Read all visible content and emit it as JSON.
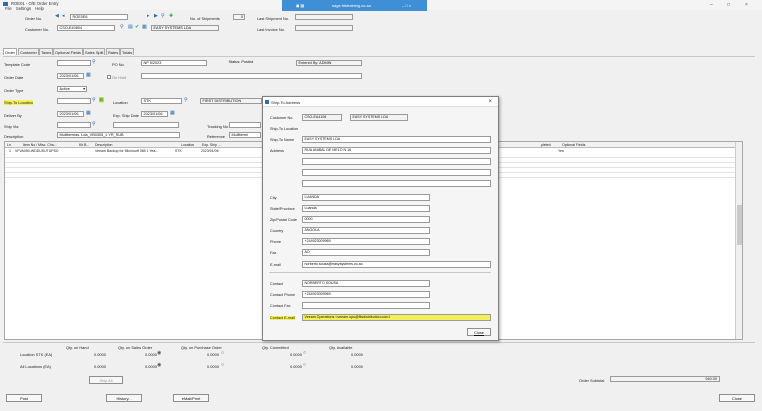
{
  "window": {
    "title": "ROE01 - O/E Order Entry",
    "menu": [
      "File",
      "Settings",
      "Help"
    ],
    "overlay_center": "sage.fitstraining.co.ao"
  },
  "header": {
    "order_no_label": "Order No.",
    "order_no": "ROE0E6",
    "no_of_shipments_label": "No. of Shipments",
    "no_of_shipments": "0",
    "last_shipment_label": "Last Shipment No.",
    "last_shipment": "",
    "customer_no_label": "Customer No.",
    "customer_no": "CSO-E40804",
    "customer_name": "EASY SYSTEMS LDA",
    "last_invoice_label": "Last Invoice No.",
    "last_invoice": ""
  },
  "tabs": [
    "Order",
    "Customer",
    "Taxes",
    "Optional Fields",
    "Sales Split",
    "Rates",
    "Totals"
  ],
  "order_tab": {
    "template_code_label": "Template Code",
    "template_code": "",
    "po_no_label": "PO No.",
    "po_no": "NP 5/2023",
    "status_text": "Status: Posted",
    "entered_by_text": "Entered By: ADMIN",
    "order_date_label": "Order Date",
    "order_date": "2023/01/06",
    "on_hold_label": "On Hold",
    "order_type_label": "Order Type",
    "order_type": "Active",
    "ship_to_location_label": "Ship-To Location",
    "ship_to_location": "",
    "location_label": "Location",
    "location": "STK",
    "location_desc": "FIRST DISTRIBUTION",
    "deliver_by_label": "Deliver By",
    "deliver_by": "2023/01/06",
    "exp_ship_date_label": "Exp. Ship Date",
    "exp_ship_date": "2023/01/06",
    "ship_via_label": "Ship Via",
    "ship_via": "",
    "tracking_label": "Tracking No.",
    "description_label": "Description",
    "description": "Multitermas. Lda_VB0305_1 YR_SUB",
    "reference_label": "Reference",
    "reference": "Multitermi"
  },
  "grid": {
    "headers": [
      "Ln",
      "Item No./ Misc. Cha...",
      "Kit B...",
      "Description",
      "Location",
      "Exp. Ship ...",
      "pleted",
      "Optional Fields"
    ],
    "rows": [
      {
        "ln": "1",
        "item": "VFVA050-WDDUSUTUPSD",
        "desc": "Veeam Backup for Microsoft 365  1 Yea...",
        "location": "STK",
        "exp_ship": "2023/01/06",
        "completed": "",
        "optional": "Yes"
      }
    ]
  },
  "summary": {
    "col_headers": [
      "Qty. on Hand",
      "Qty. on Sales Order",
      "Qty. on Purchase Order",
      "Qty. Committed",
      "Qty. Available"
    ],
    "row1_label": "Location  STK (EA)",
    "row1": [
      "0.0000",
      "0.0000",
      "0.0000",
      "0.0000",
      "0.0000"
    ],
    "row2_label": "All Locations (EA)",
    "row2": [
      "0.0000",
      "0.0000",
      "0.0000",
      "0.0000",
      "0.0000"
    ],
    "ship_all_label": "Ship All",
    "order_subtotal_label": "Order Subtotal",
    "order_subtotal": "940.00"
  },
  "bottom_buttons": {
    "post": "Post",
    "history": "History...",
    "print": "eMail/Print",
    "close": "Close"
  },
  "ship_to_dialog": {
    "title": "Ship-To Address",
    "customer_no_label": "Customer No.",
    "customer_no": "CSO-EA4108",
    "customer_name": "EASY SYSTEMS LDA",
    "ship_to_location_label": "Ship-To Location",
    "ship_to_location": "",
    "ship_to_name_label": "Ship-To Name",
    "ship_to_name": "EASY SYSTEMS LDA",
    "address_label": "Address",
    "address_lines": [
      "RUA ANIBAL DE MELO N 16",
      "",
      "",
      ""
    ],
    "city_label": "City",
    "city": "LUANDA",
    "state_label": "State/Province",
    "state": "Luanda",
    "zip_label": "Zip/Postal Code",
    "zip": "0000",
    "country_label": "Country",
    "country": "ANGOLA",
    "phone_label": "Phone",
    "phone": "+244923009969",
    "fax_label": "Fax",
    "fax": "AO",
    "email_label": "E-mail",
    "email": "norberto.sousa@easysystems.co.ao",
    "contact_label": "Contact",
    "contact": "NORBERTO SOUSA",
    "contact_phone_label": "Contact Phone",
    "contact_phone": "+244923009969",
    "contact_fax_label": "Contact Fax",
    "contact_fax": "",
    "contact_email_label": "Contact E-mail",
    "contact_email": "Veeam Operations <veeam.ops@fitsdistribution.com.l",
    "close_label": "Close"
  },
  "colors": {
    "highlight": "#f3f05a",
    "overlay": "#3f8fd6",
    "link": "#2b6cb0"
  }
}
